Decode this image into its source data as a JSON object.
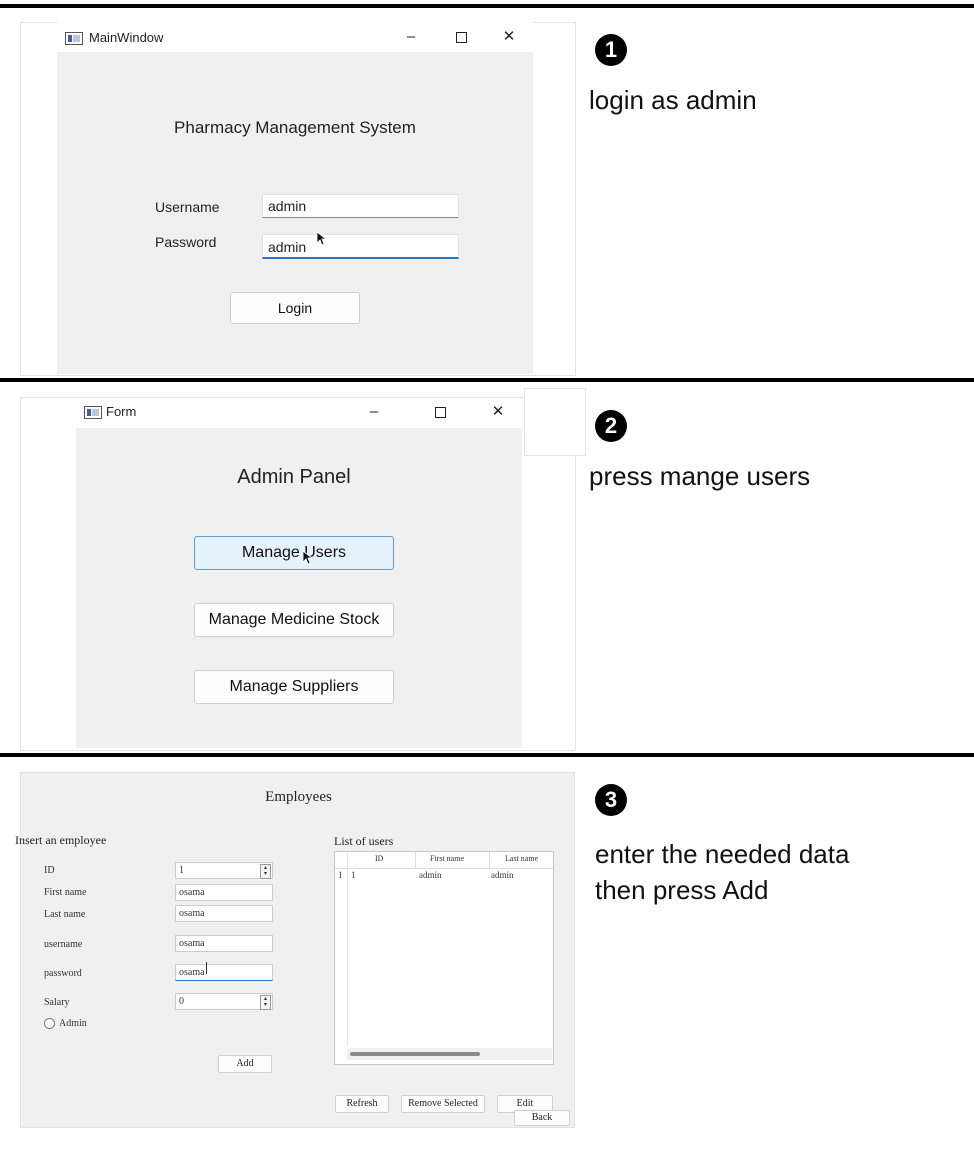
{
  "step1": {
    "badge": "1",
    "instruction": "login as admin",
    "window": {
      "title": "MainWindow",
      "app_title": "Pharmacy Management System",
      "username_label": "Username",
      "username_value": "admin",
      "password_label": "Password",
      "password_value": "admin",
      "login_button": "Login"
    }
  },
  "step2": {
    "badge": "2",
    "instruction": "press mange users",
    "window": {
      "title": "Form",
      "heading": "Admin Panel",
      "buttons": [
        "Manage Users",
        "Manage Medicine Stock",
        "Manage Suppliers"
      ]
    }
  },
  "step3": {
    "badge": "3",
    "instruction_line1": "enter the needed data",
    "instruction_line2": "then press Add",
    "window": {
      "heading": "Employees",
      "insert_title": "Insert an employee",
      "fields": [
        {
          "label": "ID",
          "value": "1"
        },
        {
          "label": "First name",
          "value": "osama"
        },
        {
          "label": "Last name",
          "value": "osama"
        },
        {
          "label": "username",
          "value": "osama"
        },
        {
          "label": "password",
          "value": "osama"
        },
        {
          "label": "Salary",
          "value": "0"
        }
      ],
      "admin_radio": "Admin",
      "add_button": "Add",
      "list_title": "List of users",
      "table": {
        "columns": [
          "ID",
          "First name",
          "Last name"
        ],
        "rows": [
          {
            "row_header": "1",
            "cells": [
              "1",
              "admin",
              "admin"
            ]
          }
        ]
      },
      "refresh_button": "Refresh",
      "remove_button": "Remove Selected",
      "edit_button": "Edit",
      "back_button": "Back"
    }
  },
  "window_controls": {
    "minimize": "–",
    "close": "✕"
  }
}
